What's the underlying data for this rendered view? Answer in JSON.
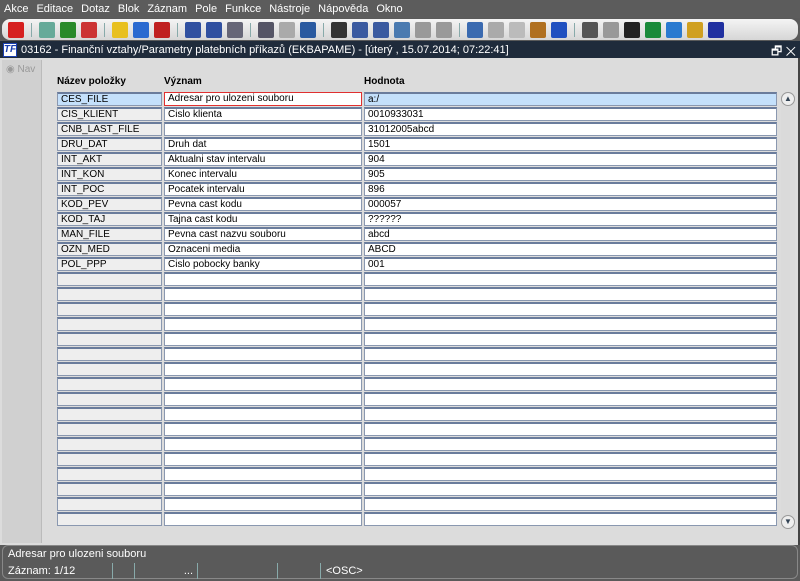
{
  "menu": [
    "Akce",
    "Editace",
    "Dotaz",
    "Blok",
    "Záznam",
    "Pole",
    "Funkce",
    "Nástroje",
    "Nápověda",
    "Okno"
  ],
  "toolbar": [
    {
      "name": "exit-icon",
      "color": "#d62020"
    },
    {
      "sep": true
    },
    {
      "name": "insert-record-icon",
      "color": "#6a9"
    },
    {
      "name": "save-record-icon",
      "color": "#2a8a2a"
    },
    {
      "name": "delete-record-icon",
      "color": "#c33"
    },
    {
      "sep": true
    },
    {
      "name": "query-enter-icon",
      "color": "#e8c020"
    },
    {
      "name": "query-execute-icon",
      "color": "#2a6ad0"
    },
    {
      "name": "query-cancel-icon",
      "color": "#c02020"
    },
    {
      "sep": true
    },
    {
      "name": "sort-asc-icon",
      "color": "#3050a0"
    },
    {
      "name": "sort-desc-icon",
      "color": "#3050a0"
    },
    {
      "name": "filter-icon",
      "color": "#667"
    },
    {
      "sep": true
    },
    {
      "name": "print-icon",
      "color": "#556"
    },
    {
      "name": "print-setup-icon",
      "color": "#aaa"
    },
    {
      "name": "mail-icon",
      "color": "#2a5aa0"
    },
    {
      "sep": true
    },
    {
      "name": "cut-icon",
      "color": "#333"
    },
    {
      "name": "copy-icon",
      "color": "#3a5aa0"
    },
    {
      "name": "paste-icon",
      "color": "#3a5aa0"
    },
    {
      "name": "search-icon",
      "color": "#4a7ab0"
    },
    {
      "name": "list-icon",
      "color": "#999"
    },
    {
      "name": "columns-icon",
      "color": "#999"
    },
    {
      "sep": true
    },
    {
      "name": "form-icon",
      "color": "#3a6ab0"
    },
    {
      "name": "document-icon",
      "color": "#aaa"
    },
    {
      "name": "globe-icon",
      "color": "#bbb"
    },
    {
      "name": "wheel-icon",
      "color": "#b07020"
    },
    {
      "name": "eye-icon",
      "color": "#2050c0"
    },
    {
      "sep": true
    },
    {
      "name": "chart-icon",
      "color": "#555"
    },
    {
      "name": "clock-icon",
      "color": "#999"
    },
    {
      "name": "sum-icon",
      "color": "#222"
    },
    {
      "name": "excel-icon",
      "color": "#1a8a3a"
    },
    {
      "name": "ie-icon",
      "color": "#2a7ad0"
    },
    {
      "name": "help-icon",
      "color": "#d0a020"
    },
    {
      "name": "context-help-icon",
      "color": "#2030a0"
    }
  ],
  "window": {
    "logo": "TF",
    "title": "03162 - Finanční vztahy/Parametry platebních příkazů (EKBAPAME) - [úterý  , 15.07.2014; 07:22:41]"
  },
  "nav": "Nav",
  "columns": {
    "name": "Název položky",
    "meaning": "Význam",
    "value": "Hodnota"
  },
  "rows": [
    [
      "CES_FILE",
      "Adresar pro ulozeni souboru",
      "a:/"
    ],
    [
      "CIS_KLIENT",
      "Cislo klienta",
      "0010933031"
    ],
    [
      "CNB_LAST_FILE",
      "",
      "31012005abcd"
    ],
    [
      "DRU_DAT",
      "Druh dat",
      "1501"
    ],
    [
      "INT_AKT",
      "Aktualni stav intervalu",
      "904"
    ],
    [
      "INT_KON",
      "Konec intervalu",
      "905"
    ],
    [
      "INT_POC",
      "Pocatek intervalu",
      "896"
    ],
    [
      "KOD_PEV",
      "Pevna cast kodu",
      "000057"
    ],
    [
      "KOD_TAJ",
      "Tajna cast kodu",
      "??????"
    ],
    [
      "MAN_FILE",
      "Pevna cast nazvu souboru",
      "abcd"
    ],
    [
      "OZN_MED",
      "Oznaceni media",
      "ABCD"
    ],
    [
      "POL_PPP",
      "Cislo pobocky banky",
      "001"
    ]
  ],
  "total_rows": 29,
  "selected_row": 0,
  "status": {
    "message": "Adresar pro ulozeni souboru",
    "record": "Záznam: 1/12",
    "ellipsis": "...",
    "mode": "<OSC>"
  }
}
